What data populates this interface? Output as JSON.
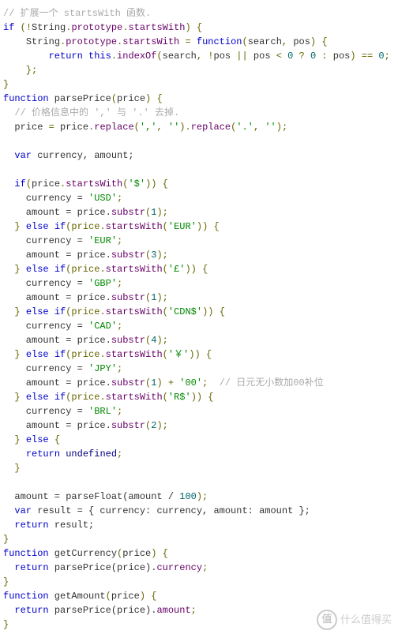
{
  "code": {
    "l01a": "// 扩展一个 startsWith 函数.",
    "l02_if": "if",
    "l02a": " (",
    "l02_not": "!",
    "l02_String": "String",
    "l02_proto": "prototype",
    "l02_sw": "startsWith",
    "l02b": ") {",
    "l03_String": "String",
    "l03_proto": "prototype",
    "l03_sw": "startsWith",
    "l03_eq": " = ",
    "l03_fn": "function",
    "l03_args_a": "(",
    "l03_search": "search",
    "l03_comma": ", ",
    "l03_pos": "pos",
    "l03_args_b": ") {",
    "l04_ret": "return",
    "l04_this": "this",
    "l04_idx": "indexOf",
    "l04_a": "(",
    "l04_search": "search",
    "l04_c1": ", ",
    "l04_not": "!",
    "l04_pos1": "pos",
    "l04_or": " || ",
    "l04_pos2": "pos",
    "l04_lt": " < ",
    "l04_z1": "0",
    "l04_q": " ? ",
    "l04_z2": "0",
    "l04_col": " : ",
    "l04_pos3": "pos",
    "l04_b": ")",
    "l04_eq": " == ",
    "l04_z3": "0",
    "l04_semi": ";",
    "l05": "    };",
    "l06": "}",
    "l07_fn": "function",
    "l07_name": " parsePrice",
    "l07_a": "(",
    "l07_price": "price",
    "l07_b": ") {",
    "l08": "  // 价格信息中的 ',' 与 '.' 去掉.",
    "l09_price": "price",
    "l09_eq": " = ",
    "l09_price2": "price",
    "l09_rep": "replace",
    "l09_a": "(",
    "l09_s1": "','",
    "l09_c": ", ",
    "l09_s2": "''",
    "l09_b": ").",
    "l09_rep2": "replace",
    "l09_a2": "(",
    "l09_s3": "'.'",
    "l09_c2": ", ",
    "l09_s4": "''",
    "l09_b2": ");",
    "l11_var": "var",
    "l11_names": " currency, amount;",
    "l13_if": "if",
    "l13_a": "(",
    "l13_price": "price",
    "l13_sw": "startsWith",
    "l13_b": "(",
    "l13_s": "'$'",
    "l13_c": ")) {",
    "l14_cur": "    currency = ",
    "l14_s": "'USD'",
    "l14_e": ";",
    "l15_amt": "    amount = price.",
    "l15_sub": "substr",
    "l15_a": "(",
    "l15_n": "1",
    "l15_b": ");",
    "l16_else": "else",
    "l16_if": "if",
    "l16_a": "(price.",
    "l16_sw": "startsWith",
    "l16_b": "(",
    "l16_s": "'EUR'",
    "l16_c": ")) {",
    "l17_cur": "    currency = ",
    "l17_s": "'EUR'",
    "l17_e": ";",
    "l18_amt": "    amount = price.",
    "l18_sub": "substr",
    "l18_a": "(",
    "l18_n": "3",
    "l18_b": ");",
    "l19_else": "else",
    "l19_if": "if",
    "l19_a": "(price.",
    "l19_sw": "startsWith",
    "l19_b": "(",
    "l19_s": "'£'",
    "l19_c": ")) {",
    "l20_cur": "    currency = ",
    "l20_s": "'GBP'",
    "l20_e": ";",
    "l21_amt": "    amount = price.",
    "l21_sub": "substr",
    "l21_a": "(",
    "l21_n": "1",
    "l21_b": ");",
    "l22_else": "else",
    "l22_if": "if",
    "l22_a": "(price.",
    "l22_sw": "startsWith",
    "l22_b": "(",
    "l22_s": "'CDN$'",
    "l22_c": ")) {",
    "l23_cur": "    currency = ",
    "l23_s": "'CAD'",
    "l23_e": ";",
    "l24_amt": "    amount = price.",
    "l24_sub": "substr",
    "l24_a": "(",
    "l24_n": "4",
    "l24_b": ");",
    "l25_else": "else",
    "l25_if": "if",
    "l25_a": "(price.",
    "l25_sw": "startsWith",
    "l25_b": "(",
    "l25_s": "'￥'",
    "l25_c": ")) {",
    "l26_cur": "    currency = ",
    "l26_s": "'JPY'",
    "l26_e": ";",
    "l27_amt": "    amount = price.",
    "l27_sub": "substr",
    "l27_a": "(",
    "l27_n": "1",
    "l27_b": ") + ",
    "l27_s": "'00'",
    "l27_e": ";  ",
    "l27_cm": "// 日元无小数加00补位",
    "l28_else": "else",
    "l28_if": "if",
    "l28_a": "(price.",
    "l28_sw": "startsWith",
    "l28_b": "(",
    "l28_s": "'R$'",
    "l28_c": ")) {",
    "l29_cur": "    currency = ",
    "l29_s": "'BRL'",
    "l29_e": ";",
    "l30_amt": "    amount = price.",
    "l30_sub": "substr",
    "l30_a": "(",
    "l30_n": "2",
    "l30_b": ");",
    "l31": "  } ",
    "l31_else": "else",
    "l31b": " {",
    "l32_ret": "return",
    "l32_und": " undefined",
    "l32_e": ";",
    "l33": "  }",
    "l35_amt": "  amount = parseFloat(amount / ",
    "l35_n": "100",
    "l35_b": ");",
    "l36_var": "var",
    "l36_a": " result = { currency: currency, amount: amount };",
    "l37_ret": "return",
    "l37_a": " result;",
    "l38": "}",
    "l39_fn": "function",
    "l39_name": " getCurrency",
    "l39_a": "(",
    "l39_price": "price",
    "l39_b": ") {",
    "l40_ret": "return",
    "l40_a": " parsePrice(price).",
    "l40_cur": "currency",
    "l40_e": ";",
    "l41": "}",
    "l42_fn": "function",
    "l42_name": " getAmount",
    "l42_a": "(",
    "l42_price": "price",
    "l42_b": ") {",
    "l43_ret": "return",
    "l43_a": " parsePrice(price).",
    "l43_amt": "amount",
    "l43_e": ";",
    "l44": "}"
  },
  "watermark": {
    "symbol": "值",
    "text": "什么值得买"
  }
}
